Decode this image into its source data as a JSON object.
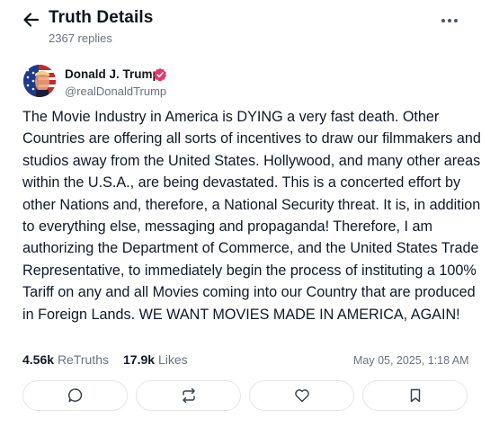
{
  "header": {
    "title": "Truth Details",
    "replies": "2367 replies"
  },
  "post": {
    "author_name": "Donald J. Trump",
    "handle": "@realDonaldTrump",
    "text": "The Movie Industry in America is DYING a very fast death. Other Countries are offering all sorts of incentives to draw our filmmakers and studios away from the United States. Hollywood, and many other areas within the U.S.A., are being devastated. This is a concerted effort by other Nations and, therefore, a National Security threat. It is, in addition to everything else, messaging and propaganda! Therefore, I am authorizing the Department of Commerce, and the United States Trade Representative, to immediately begin the process of instituting a 100% Tariff on any and all Movies coming into our Country that are produced in Foreign Lands. WE WANT MOVIES MADE IN AMERICA, AGAIN!",
    "retruths_count": "4.56k",
    "retruths_label": "ReTruths",
    "likes_count": "17.9k",
    "likes_label": "Likes",
    "timestamp": "May 05, 2025, 1:18 AM"
  },
  "icons": {
    "back": "arrow-left-icon",
    "more": "more-horizontal-icon",
    "verified": "verified-badge-icon",
    "reply": "comment-icon",
    "retruth": "repost-icon",
    "like": "heart-icon",
    "bookmark": "bookmark-icon"
  },
  "colors": {
    "verified_badge": "#e8356d",
    "secondary_text": "#6b7280",
    "button_border": "#e3e5e8"
  }
}
